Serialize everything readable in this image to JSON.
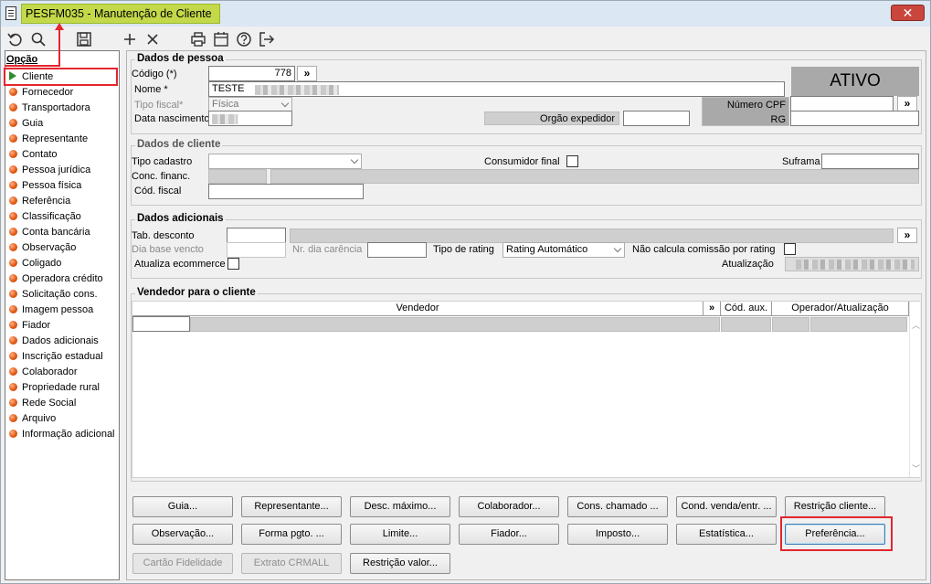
{
  "window": {
    "title": "PESFM035 - Manutenção de Cliente",
    "close_label": "✕"
  },
  "toolbar": {
    "icons": [
      "undo-icon",
      "search-icon",
      "save-icon",
      "add-icon",
      "delete-icon",
      "print-icon",
      "calendar-icon",
      "help-icon",
      "exit-icon"
    ]
  },
  "sidebar": {
    "header": "Opção",
    "items": [
      {
        "label": "Cliente",
        "selected": true
      },
      {
        "label": "Fornecedor"
      },
      {
        "label": "Transportadora"
      },
      {
        "label": "Guia"
      },
      {
        "label": "Representante"
      },
      {
        "label": "Contato"
      },
      {
        "label": "Pessoa jurídica"
      },
      {
        "label": "Pessoa física"
      },
      {
        "label": "Referência"
      },
      {
        "label": "Classificação"
      },
      {
        "label": "Conta bancária"
      },
      {
        "label": "Observação"
      },
      {
        "label": "Coligado"
      },
      {
        "label": "Operadora crédito"
      },
      {
        "label": "Solicitação cons."
      },
      {
        "label": "Imagem pessoa"
      },
      {
        "label": "Fiador"
      },
      {
        "label": "Dados adicionais"
      },
      {
        "label": "Inscrição estadual"
      },
      {
        "label": "Colaborador"
      },
      {
        "label": "Propriedade rural"
      },
      {
        "label": "Rede Social"
      },
      {
        "label": "Arquivo"
      },
      {
        "label": "Informação adicional"
      }
    ]
  },
  "pessoa": {
    "group_title": "Dados de pessoa",
    "codigo_label": "Código (*)",
    "codigo_value": "778",
    "nome_label": "Nome *",
    "nome_value": "TESTE",
    "tipo_fiscal_label": "Tipo fiscal*",
    "tipo_fiscal_value": "Física",
    "data_nasc_label": "Data nascimento",
    "orgao_label": "Orgão expedidor",
    "status": "ATIVO",
    "cpf_label": "Número CPF",
    "rg_label": "RG",
    "more_label": "»"
  },
  "cliente": {
    "group_title": "Dados de cliente",
    "tipo_cadastro_label": "Tipo cadastro",
    "consumidor_label": "Consumidor final",
    "suframa_label": "Suframa",
    "conc_financ_label": "Conc. financ.",
    "cod_fiscal_label": "Cód. fiscal"
  },
  "adicionais": {
    "group_title": "Dados adicionais",
    "tab_desconto_label": "Tab. desconto",
    "dia_base_label": "Dia base vencto",
    "nr_dia_label": "Nr. dia carência",
    "tipo_rating_label": "Tipo de rating",
    "tipo_rating_value": "Rating Automático",
    "nao_calcula_label": "Não calcula comissão por rating",
    "atualiza_label": "Atualiza ecommerce",
    "atualizacao_label": "Atualização",
    "more_label": "»"
  },
  "vendedor": {
    "group_title": "Vendedor para o cliente",
    "columns": [
      "Vendedor",
      "»",
      "Cód. aux.",
      "Operador/Atualização"
    ]
  },
  "buttons": {
    "row1": [
      "Guia...",
      "Representante...",
      "Desc. máximo...",
      "Colaborador...",
      "Cons. chamado ...",
      "Cond. venda/entr. ...",
      "Restrição cliente..."
    ],
    "row2": [
      "Observação...",
      "Forma pgto. ...",
      "Limite...",
      "Fiador...",
      "Imposto...",
      "Estatística...",
      "Preferência..."
    ],
    "row3": [
      "Cartão Fidelidade",
      "Extrato CRMALL",
      "Restrição valor..."
    ]
  },
  "colors": {
    "title_highlight": "#c3d94a",
    "annotation_red": "#e3262f",
    "bullet_orange": "#e25b13",
    "selected_green": "#2e8b2e"
  }
}
